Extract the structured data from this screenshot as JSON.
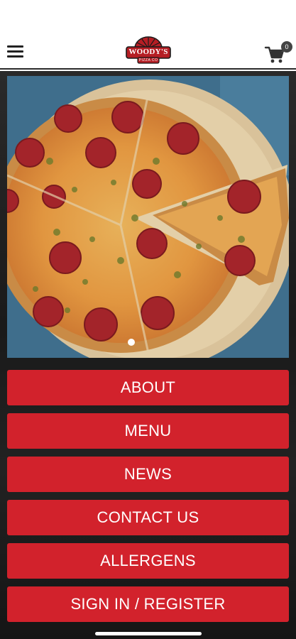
{
  "header": {
    "logo_text": "WOODY'S",
    "logo_sub": "PIZZA CO",
    "cart_count": "0"
  },
  "hero": {
    "slide_count": 1,
    "active_slide": 1
  },
  "menu": {
    "about": "ABOUT",
    "menu": "MENU",
    "news": "NEWS",
    "contact": "CONTACT US",
    "allergens": "ALLERGENS",
    "sign_in": "SIGN IN / REGISTER"
  },
  "colors": {
    "button_red": "#d2222c",
    "header_bg": "#ffffff",
    "page_bg": "#1f1f1f"
  },
  "icons": {
    "menu": "hamburger-icon",
    "cart": "cart-icon"
  }
}
